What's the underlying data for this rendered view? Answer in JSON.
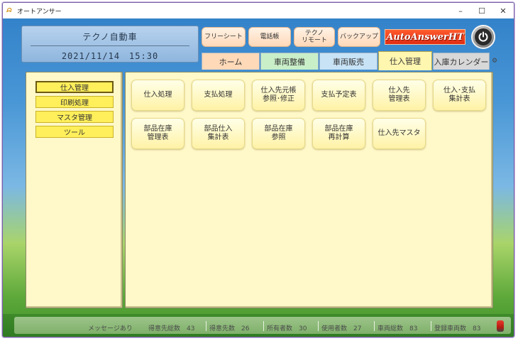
{
  "window": {
    "title": "オートアンサー",
    "controls": {
      "minimize": "–",
      "maximize": "☐",
      "close": "✕"
    }
  },
  "header": {
    "company": "テクノ自動車",
    "datetime": "2021/11/14　15:30"
  },
  "top_buttons": {
    "free_sheet": "フリーシート",
    "phonebook": "電話帳",
    "techno_remote": "テクノ\nリモート",
    "backup": "バックアップ"
  },
  "brand": {
    "logo_text": "AutoAnswerHT"
  },
  "nav_tabs": [
    {
      "label": "ホーム",
      "color": "#ffd9b8"
    },
    {
      "label": "車両整備",
      "color": "#c9efc9"
    },
    {
      "label": "車両販売",
      "color": "#c8e3f6"
    },
    {
      "label": "仕入管理",
      "color": "#fff6b0"
    },
    {
      "label": "入庫カレンダー",
      "color": "#d8d8d8"
    }
  ],
  "sidebar": {
    "items": [
      {
        "label": "仕入管理",
        "active": true
      },
      {
        "label": "印刷処理",
        "active": false
      },
      {
        "label": "マスタ管理",
        "active": false
      },
      {
        "label": "ツール",
        "active": false
      }
    ]
  },
  "functions": {
    "row1": [
      "仕入処理",
      "支払処理",
      "仕入先元帳\n参照･修正",
      "支払予定表",
      "仕入先\n管理表",
      "仕入･支払\n集計表"
    ],
    "row2": [
      "部品在庫\n管理表",
      "部品仕入\n集計表",
      "部品在庫\n参照",
      "部品在庫\n再計算",
      "仕入先マスタ"
    ]
  },
  "status": {
    "message": "メッセージあり",
    "customers": "得意先総数　43",
    "customer_count": "得意先数　26",
    "owners": "所有者数　30",
    "users": "使用者数　27",
    "vehicles_total": "車両総数　83",
    "registered_vehicles": "登録車両数　83"
  },
  "colors": {
    "accent_orange": "#ffd9b8",
    "panel_yellow": "#fff8c8",
    "side_yellow": "#ffef5a",
    "brand_red": "#e02c12"
  }
}
